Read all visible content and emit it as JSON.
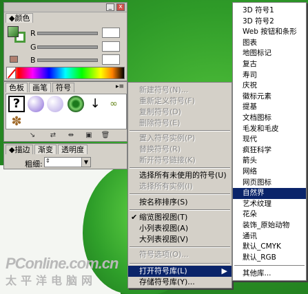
{
  "color_panel": {
    "title": "颜色",
    "slider_labels": [
      "R",
      "G",
      "B"
    ],
    "minimize_glyph": "_",
    "close_glyph": "x"
  },
  "symbols_panel": {
    "tabs": [
      "色板",
      "画笔",
      "符号"
    ],
    "active_tab": "符号"
  },
  "stroke_panel": {
    "tabs": [
      "描边",
      "渐变",
      "透明度"
    ],
    "weight_label": "粗细:",
    "weight_value": ""
  },
  "symbol_menu": {
    "items": [
      {
        "label": "新建符号(N)...",
        "enabled": false
      },
      {
        "label": "重新定义符号(F)",
        "enabled": false
      },
      {
        "label": "复制符号(D)",
        "enabled": false
      },
      {
        "label": "删除符号(E)",
        "enabled": false
      },
      {
        "label": "置入符号实例(P)",
        "enabled": false
      },
      {
        "label": "替换符号(R)",
        "enabled": false
      },
      {
        "label": "断开符号链接(K)",
        "enabled": false
      },
      {
        "label": "选择所有未使用的符号(U)",
        "enabled": true
      },
      {
        "label": "选择所有实例(I)",
        "enabled": false
      },
      {
        "label": "按名称排序(S)",
        "enabled": true
      },
      {
        "label": "缩览图视图(T)",
        "enabled": true,
        "checked": true
      },
      {
        "label": "小列表视图(A)",
        "enabled": true
      },
      {
        "label": "大列表视图(V)",
        "enabled": true
      },
      {
        "label": "符号选项(O)...",
        "enabled": false
      },
      {
        "label": "打开符号库(L)",
        "enabled": true,
        "submenu": true,
        "highlighted": true
      },
      {
        "label": "存储符号库(Y)...",
        "enabled": true
      }
    ]
  },
  "library_menu": {
    "items": [
      "3D 符号1",
      "3D 符号2",
      "Web 按钮和条形",
      "图表",
      "地图标记",
      "复古",
      "寿司",
      "庆祝",
      "徽标元素",
      "提基",
      "文档图标",
      "毛发和毛皮",
      "现代",
      "疯狂科学",
      "箭头",
      "网络",
      "网页图标",
      "自然界",
      "艺术纹理",
      "花朵",
      "装饰_原始动物",
      "通讯",
      "默认_CMYK",
      "默认_RGB",
      "其他库..."
    ],
    "selected": "自然界"
  },
  "watermark": {
    "line1": "PConline.com.cn",
    "line2": "太平洋电脑网"
  },
  "colors": {
    "menu_highlight": "#0a246a",
    "panel_bg": "#d4d0c8"
  }
}
